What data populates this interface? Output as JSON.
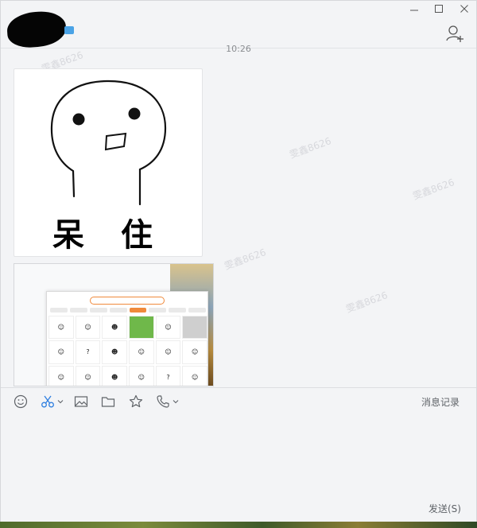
{
  "window": {
    "timestamp": "10:26",
    "controls": {
      "minimize_icon": "minimize-icon",
      "maximize_icon": "maximize-icon",
      "close_icon": "close-icon"
    },
    "accent_color": "#4aa3e6"
  },
  "messages": {
    "sticker": {
      "caption": "呆 住"
    },
    "screenshot": {
      "content": "emoji picker screenshot"
    }
  },
  "watermark": "雯鑫8626",
  "toolbar": {
    "icons": [
      "emoji-icon",
      "scissors-icon",
      "image-icon",
      "folder-icon",
      "star-icon",
      "phone-icon"
    ],
    "history_label": "消息记录",
    "send_label": "发送(S)"
  }
}
